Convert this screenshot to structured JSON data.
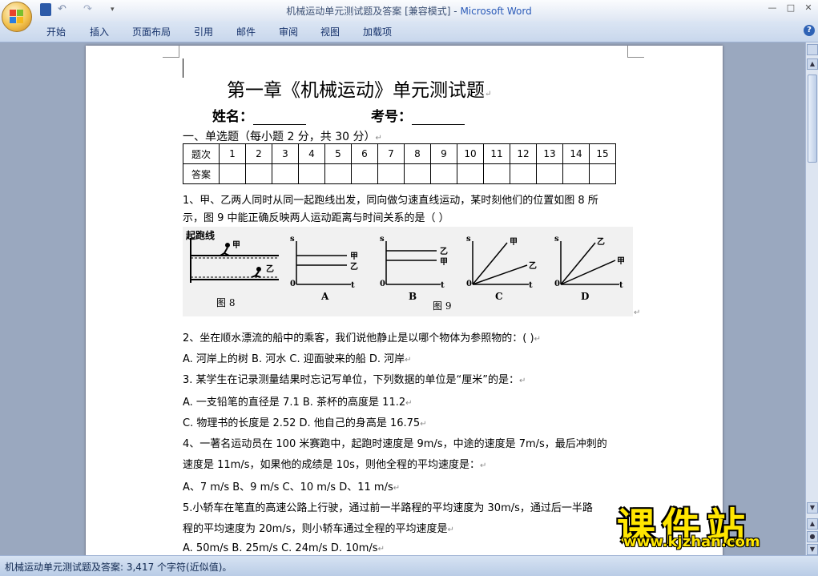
{
  "window": {
    "doc_name": "机械运动单元测试题及答案 [兼容模式]",
    "separator": " - ",
    "app_name": "Microsoft Word",
    "min": "—",
    "max": "□",
    "close": "✕"
  },
  "ribbon": {
    "tabs": [
      "开始",
      "插入",
      "页面布局",
      "引用",
      "邮件",
      "审阅",
      "视图",
      "加载项"
    ],
    "help": "?"
  },
  "document": {
    "title": "第一章《机械运动》单元测试题",
    "name_label": "姓名：",
    "id_label": "考号：",
    "section1": "一、单选题（每小题 2 分，共 30 分）",
    "table": {
      "row1_header": "题次",
      "row2_header": "答案",
      "numbers": [
        "1",
        "2",
        "3",
        "4",
        "5",
        "6",
        "7",
        "8",
        "9",
        "10",
        "11",
        "12",
        "13",
        "14",
        "15"
      ]
    },
    "q1_line1": "1、甲、乙两人同时从同一起跑线出发，同向做匀速直线运动，某时刻他们的位置如图 8 所",
    "q1_line2": "示，图 9 中能正确反映两人运动距离与时间关系的是（      ）",
    "figures": {
      "start_line": "起跑线",
      "jia": "甲",
      "yi": "乙",
      "fig8": "图 8",
      "fig9": "图 9",
      "s": "s",
      "t": "t",
      "o": "0",
      "opts": [
        "A",
        "B",
        "C",
        "D"
      ]
    },
    "q2": "2、坐在顺水漂流的船中的乘客，我们说他静止是以哪个物体为参照物的：(        )",
    "q2_opts": "A. 河岸上的树        B. 河水        C. 迎面驶来的船        D. 河岸",
    "q3": "3. 某学生在记录测量结果时忘记写单位，下列数据的单位是“厘米”的是：",
    "q3_opts1": "A. 一支铅笔的直径是 7.1           B. 茶杯的高度是 11.2",
    "q3_opts2": "C. 物理书的长度是 2.52            D. 他自己的身高是 16.75",
    "q4_line1": "4、一著名运动员在 100 米赛跑中，起跑时速度是 9m/s，中途的速度是 7m/s，最后冲刺的",
    "q4_line2": "速度是 11m/s，如果他的成绩是 10s，则他全程的平均速度是：",
    "q4_opts": "A、7  m/s              B、9  m/s              C、10  m/s              D、11  m/s",
    "q5_line1": "5.小轿车在笔直的高速公路上行驶，通过前一半路程的平均速度为 30m/s，通过后一半路",
    "q5_line2": "程的平均速度为 20m/s，则小轿车通过全程的平均速度是",
    "q5_opts": "A. 50m/s    B. 25m/s     C. 24m/s     D. 10m/s",
    "para_mark": "↵"
  },
  "status": {
    "text": "机械运动单元测试题及答案: 3,417 个字符(近似值)。"
  },
  "watermark": {
    "title": "课件站",
    "url": "www.kjzhan.com"
  }
}
